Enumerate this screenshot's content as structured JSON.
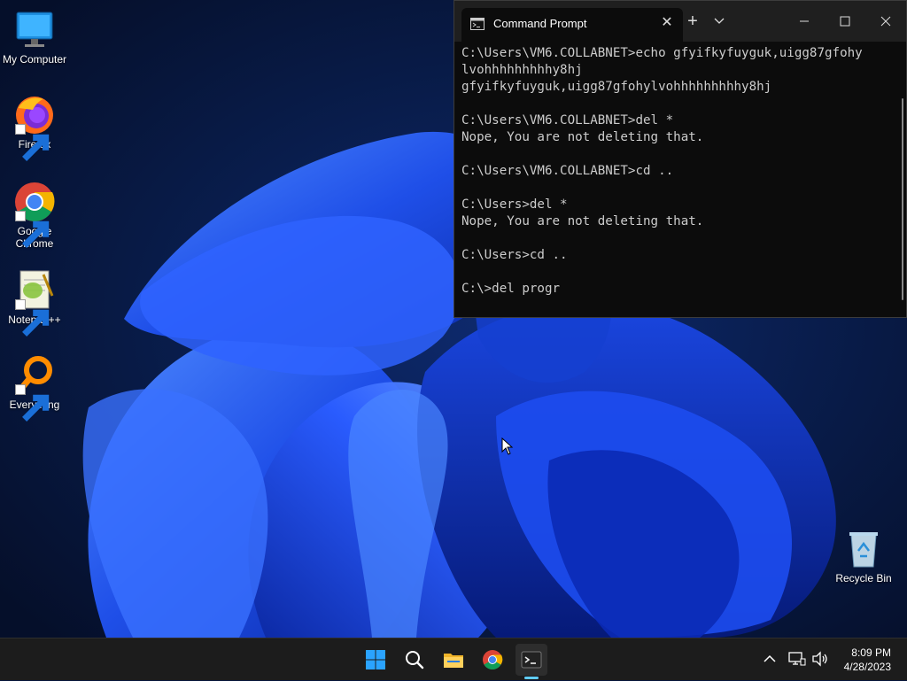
{
  "desktop": {
    "icons": [
      {
        "label": "My Computer"
      },
      {
        "label": "Firefox"
      },
      {
        "label": "Google Chrome"
      },
      {
        "label": "Notepad++"
      },
      {
        "label": "Everything"
      },
      {
        "label": "Recycle Bin"
      }
    ]
  },
  "window": {
    "tab_title": "Command Prompt",
    "tab_icon": "terminal-icon",
    "lines": [
      "C:\\Users\\VM6.COLLABNET>echo gfyifkyfuyguk,uigg87gfohy",
      "lvohhhhhhhhhy8hj",
      "gfyifkyfuyguk,uigg87gfohylvohhhhhhhhhy8hj",
      "",
      "C:\\Users\\VM6.COLLABNET>del *",
      "Nope, You are not deleting that.",
      "",
      "C:\\Users\\VM6.COLLABNET>cd ..",
      "",
      "C:\\Users>del *",
      "Nope, You are not deleting that.",
      "",
      "C:\\Users>cd ..",
      "",
      "C:\\>del progr"
    ]
  },
  "taskbar": {
    "apps": [
      "start-icon",
      "search-icon",
      "file-explorer-icon",
      "chrome-icon",
      "terminal-icon"
    ],
    "time": "8:09 PM",
    "date": "4/28/2023"
  },
  "colors": {
    "accent": "#0078d4",
    "console_bg": "#0c0c0c",
    "console_fg": "#cccccc",
    "taskbar_bg": "#1c1c1c"
  }
}
